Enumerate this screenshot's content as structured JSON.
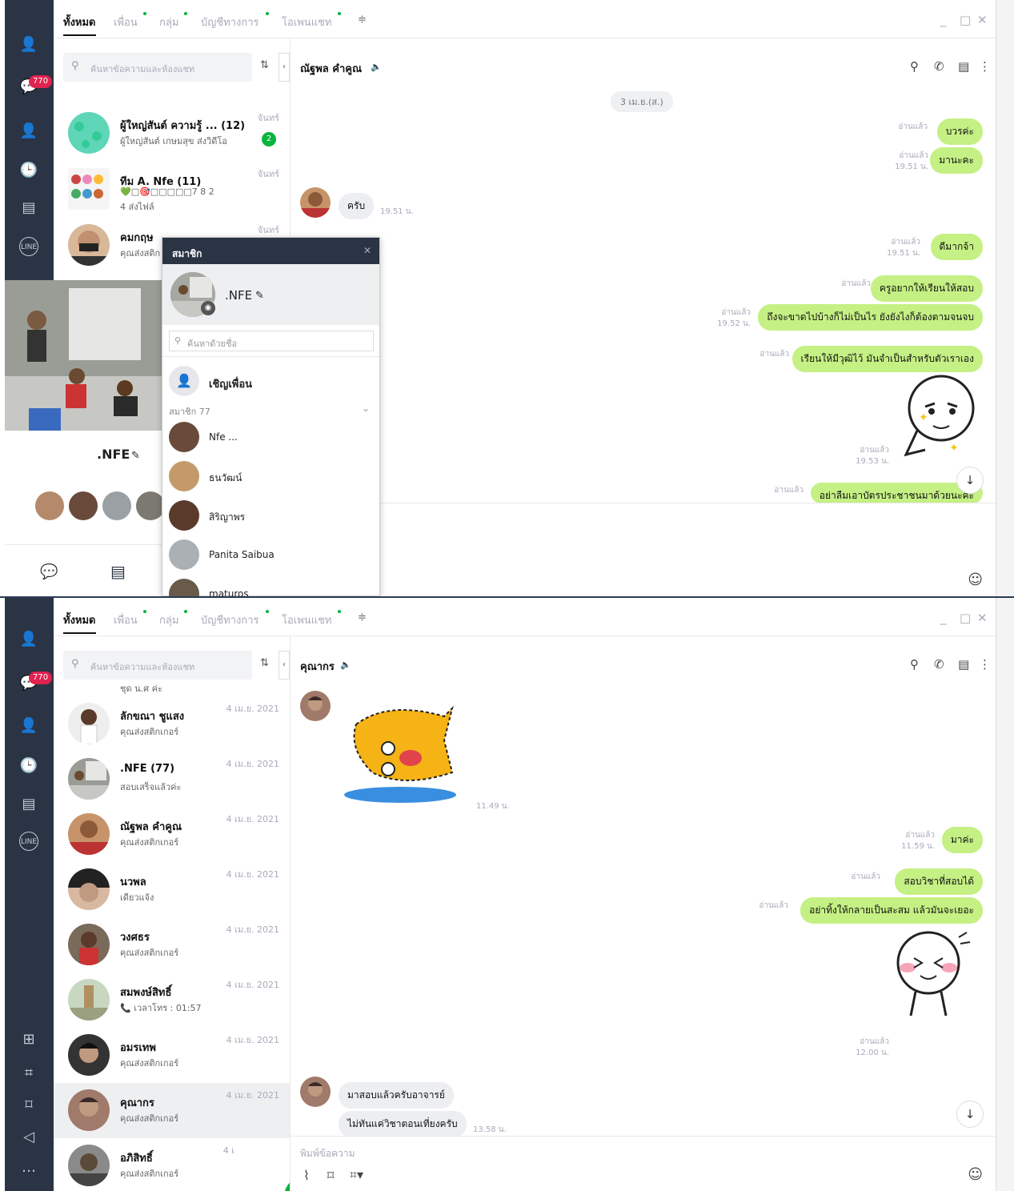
{
  "tabs": [
    {
      "label": "ทั้งหมด"
    },
    {
      "label": "เพื่อน"
    },
    {
      "label": "กลุ่ม"
    },
    {
      "label": "บัญชีทางการ"
    },
    {
      "label": "โอเพนแชท"
    }
  ],
  "badge_count": "770",
  "search_placeholder": "ค้นหาข้อความและห้องแชท",
  "top": {
    "chats": [
      {
        "name": "ผู้ใหญ่สันต์ ความรู้ ... (12)",
        "msg": "ผู้ใหญ่สันต์ เกษมสุข ส่งวิดีโอ",
        "time": "จันทร์",
        "unread": "2"
      },
      {
        "name": "ทีม A.  Nfe (11)",
        "msg": "💚□🎯□□□□□7 8 2",
        "msg2": "4 ส่งไฟล์",
        "time": "จันทร์"
      },
      {
        "name": "คมกฤษ",
        "msg": "คุณส่งสติก",
        "time": "จันทร์"
      }
    ],
    "chat_title": "ณัฐพล คำคูณ",
    "date": "3 เม.ย.(ส.)",
    "messages": [
      {
        "text": "บวรค่ะ",
        "meta": "อ่านแล้ว"
      },
      {
        "text": "มานะคะ",
        "meta": "อ่านแล้ว",
        "meta2": "19.51 น."
      },
      {
        "text": "ครับ",
        "meta": "19.51 น."
      },
      {
        "text": "ดีมากจ้า",
        "meta": "อ่านแล้ว",
        "meta2": "19.51 น."
      },
      {
        "text": "ครูอยากให้เรียนให้สอบ",
        "meta": "อ่านแล้ว"
      },
      {
        "text": "ถึงจะขาดไปบ้างก็ไม่เป็นไร ยังยังไงก็ต้องตามจนจบ",
        "meta": "อ่านแล้ว",
        "meta2": "19.52 น."
      },
      {
        "text": "เรียนให้มีวุฒิไว้ มันจำเป็นสำหรับตัวเราเอง",
        "meta": "อ่านแล้ว"
      },
      {
        "text": "sticker",
        "meta": "อ่านแล้ว",
        "meta2": "19.53 น."
      },
      {
        "text": "อย่าลืมเอาบัตรประชาชนมาด้วยนะคะ",
        "meta": "อ่านแล้ว"
      }
    ],
    "profile_name": ".NFE",
    "members_panel": {
      "title": "สมาชิก",
      "group_name": ".NFE",
      "search_placeholder": "ค้นหาด้วยชื่อ",
      "invite": "เชิญเพื่อน",
      "count_label": "สมาชิก 77",
      "members": [
        {
          "name": "Nfe ..."
        },
        {
          "name": "ธนวัฒน์"
        },
        {
          "name": "สิริญาพร"
        },
        {
          "name": "Panita Saibua"
        },
        {
          "name": "maturos"
        }
      ]
    }
  },
  "bottom": {
    "first_msg": "ชุด น.ศ ค่ะ",
    "chats": [
      {
        "name": "ลักขณา ชูแสง",
        "msg": "คุณส่งสติกเกอร์",
        "time": "4 เม.ย. 2021"
      },
      {
        "name": ".NFE (77)",
        "msg": "สอบเสร็จแล้วค่ะ",
        "time": "4 เม.ย. 2021"
      },
      {
        "name": "ณัฐพล คำคูณ",
        "msg": "คุณส่งสติกเกอร์",
        "time": "4 เม.ย. 2021"
      },
      {
        "name": "นวพล",
        "msg": "เดียวแจ้ง",
        "time": "4 เม.ย. 2021"
      },
      {
        "name": "วงศธร",
        "msg": "คุณส่งสติกเกอร์",
        "time": "4 เม.ย. 2021"
      },
      {
        "name": "สมพงษ์สิทธิ์",
        "msg": "📞 เวลาโทร : 01:57",
        "time": "4 เม.ย. 2021"
      },
      {
        "name": "อมรเทพ",
        "msg": "คุณส่งสติกเกอร์",
        "time": "4 เม.ย. 2021"
      },
      {
        "name": "คุณากร",
        "msg": "คุณส่งสติกเกอร์",
        "time": "4 เม.ย. 2021"
      },
      {
        "name": "อภิสิทธิ์",
        "msg": "คุณส่งสติกเกอร์",
        "time": "4 เ"
      }
    ],
    "chat_title": "คุณากร",
    "messages": [
      {
        "text": "sticker",
        "meta": "11.49 น."
      },
      {
        "text": "มาค่ะ",
        "meta": "อ่านแล้ว",
        "meta2": "11.59 น."
      },
      {
        "text": "สอบวิชาที่สอบได้",
        "meta": "อ่านแล้ว"
      },
      {
        "text": "อย่าทิ้งให้กลายเป็นสะสม แล้วมันจะเยอะ",
        "meta": "อ่านแล้ว"
      },
      {
        "text": "sticker",
        "meta": "อ่านแล้ว",
        "meta2": "12.00 น."
      },
      {
        "text": "มาสอบแล้วครับอาจารย์"
      },
      {
        "text": "ไม่ทันแค่วิชาตอนเที่ยงครับ",
        "meta": "13.58 น."
      }
    ],
    "input_placeholder": "พิมพ์ข้อความ"
  },
  "colors": {
    "rail": "#2b3445",
    "bubble": "#c5f084",
    "accent": "#07b53b",
    "badge": "#e0224e"
  }
}
